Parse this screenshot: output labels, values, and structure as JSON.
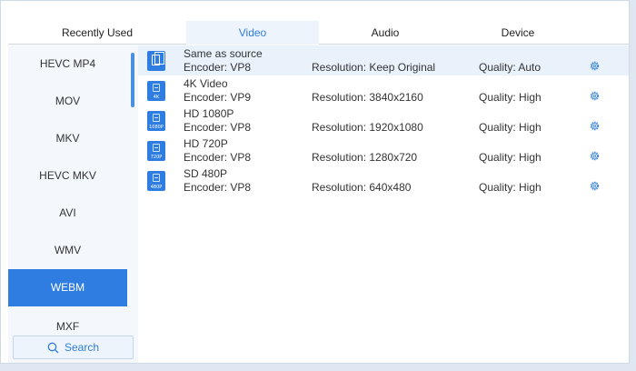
{
  "tabs": [
    {
      "label": "Recently Used"
    },
    {
      "label": "Video"
    },
    {
      "label": "Audio"
    },
    {
      "label": "Device"
    }
  ],
  "active_tab": "Video",
  "sidebar": {
    "items": [
      {
        "label": "HEVC MP4"
      },
      {
        "label": "MOV"
      },
      {
        "label": "MKV"
      },
      {
        "label": "HEVC MKV"
      },
      {
        "label": "AVI"
      },
      {
        "label": "WMV"
      },
      {
        "label": "WEBM"
      },
      {
        "label": "MXF"
      }
    ],
    "active": "WEBM",
    "search_label": "Search"
  },
  "formats": [
    {
      "name": "Same as source",
      "encoder": "Encoder: VP8",
      "resolution": "Resolution: Keep Original",
      "quality": "Quality: Auto",
      "badge": "",
      "icon": "copy-icon"
    },
    {
      "name": "4K Video",
      "encoder": "Encoder: VP9",
      "resolution": "Resolution: 3840x2160",
      "quality": "Quality: High",
      "badge": "4K",
      "icon": "video-4k-icon"
    },
    {
      "name": "HD 1080P",
      "encoder": "Encoder: VP8",
      "resolution": "Resolution: 1920x1080",
      "quality": "Quality: High",
      "badge": "1080P",
      "icon": "video-1080p-icon"
    },
    {
      "name": "HD 720P",
      "encoder": "Encoder: VP8",
      "resolution": "Resolution: 1280x720",
      "quality": "Quality: High",
      "badge": "720P",
      "icon": "video-720p-icon"
    },
    {
      "name": "SD 480P",
      "encoder": "Encoder: VP8",
      "resolution": "Resolution: 640x480",
      "quality": "Quality: High",
      "badge": "480P",
      "icon": "video-480p-icon"
    }
  ],
  "colors": {
    "accent": "#2f7de0",
    "sidebar_bg": "#f4f8fc",
    "selected_row": "#e9f2fb"
  }
}
